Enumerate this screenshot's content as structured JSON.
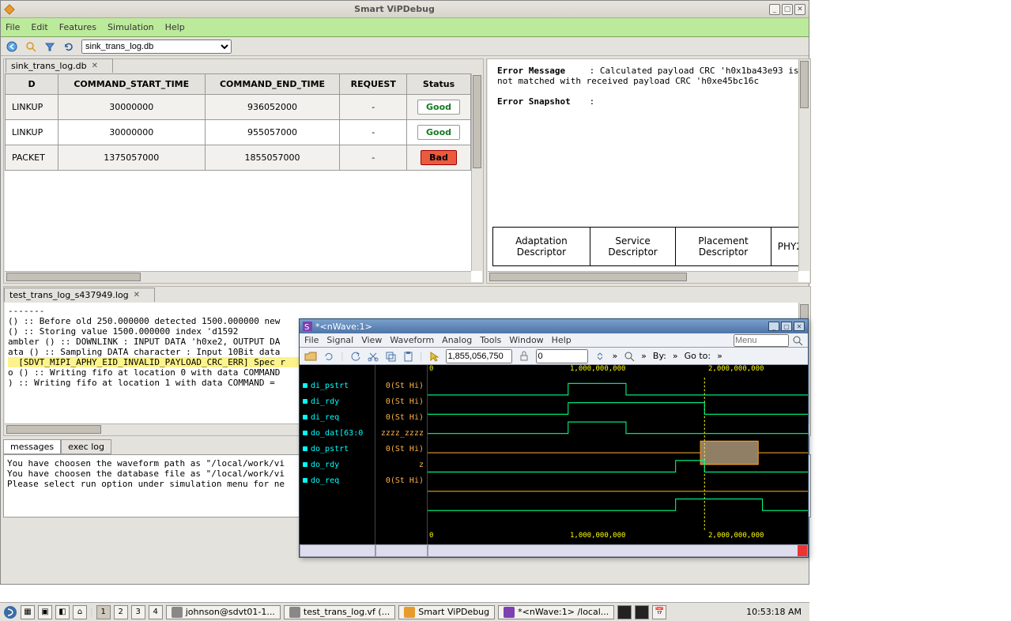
{
  "window": {
    "title": "Smart ViPDebug",
    "menu": [
      "File",
      "Edit",
      "Features",
      "Simulation",
      "Help"
    ],
    "db_selector": "sink_trans_log.db"
  },
  "trans_panel": {
    "tab": "sink_trans_log.db",
    "headers": [
      "D",
      "COMMAND_START_TIME",
      "COMMAND_END_TIME",
      "REQUEST",
      "Status"
    ],
    "rows": [
      {
        "d": "LINKUP",
        "start": "30000000",
        "end": "936052000",
        "req": "-",
        "status": "Good",
        "cls": "good"
      },
      {
        "d": "LINKUP",
        "start": "30000000",
        "end": "955057000",
        "req": "-",
        "status": "Good",
        "cls": "good"
      },
      {
        "d": "PACKET",
        "start": "1375057000",
        "end": "1855057000",
        "req": "-",
        "status": "Bad",
        "cls": "bad"
      }
    ]
  },
  "error_panel": {
    "err_label": "Error Message",
    "err_sep": ":",
    "err_text": "Calculated payload CRC 'h0x1ba43e93 is not matched with received payload CRC 'h0xe45bc16c",
    "snap_label": "Error Snapshot",
    "descriptors": [
      "Adaptation Descriptor",
      "Service Descriptor",
      "Placement Descriptor",
      "PHY2"
    ]
  },
  "log_panel": {
    "tab": "test_trans_log_s437949.log",
    "lines": [
      "-------",
      "",
      "() :: Before old 250.000000 detected 1500.000000 new",
      "() :: Storing value 1500.000000 index 'd1592",
      "ambler () :: DOWNLINK : INPUT DATA 'h0xe2, OUTPUT DA",
      "ata () :: Sampling DATA character : Input 10Bit data",
      "  [SDVT_MIPI_APHY_EID_INVALID_PAYLOAD_CRC_ERR] Spec r",
      "o () :: Writing fifo at location 0 with data COMMAND",
      ") :: Writing fifo at location 1 with data COMMAND ="
    ],
    "hl_index": 6
  },
  "msg_panel": {
    "tabs": [
      "messages",
      "exec log"
    ],
    "active": 0,
    "lines": [
      "You have choosen the waveform path as \"/local/work/vi",
      "You have choosen the database file as \"/local/work/vi",
      "Please select run option under simulation menu for ne"
    ]
  },
  "nwave": {
    "title": "*<nWave:1>",
    "menu": [
      "File",
      "Signal",
      "View",
      "Waveform",
      "Analog",
      "Tools",
      "Window",
      "Help"
    ],
    "menu_search_ph": "Menu",
    "tb_time": "1,855,056,750",
    "tb_adj": "0",
    "tb_by": "By:",
    "tb_goto": "Go to:",
    "ruler": [
      "0",
      "1,000,000,000",
      "2,000,000,000"
    ],
    "signals": [
      {
        "name": "di_pstrt",
        "val": "0(St Hi)"
      },
      {
        "name": "di_rdy",
        "val": "0(St Hi)"
      },
      {
        "name": "di_req",
        "val": "0(St Hi)"
      },
      {
        "name": "do_dat[63:0",
        "val": "zzzz_zzzz"
      },
      {
        "name": "do_pstrt",
        "val": "0(St Hi)"
      },
      {
        "name": "do_rdy",
        "val": "z"
      },
      {
        "name": "do_req",
        "val": "0(St Hi)"
      }
    ]
  },
  "taskbar": {
    "workspaces": [
      "1",
      "2",
      "3",
      "4"
    ],
    "apps": [
      "johnson@sdvt01-1...",
      "test_trans_log.vf (...",
      "Smart ViPDebug",
      "*<nWave:1> /local..."
    ],
    "clock": "10:53:18 AM"
  }
}
